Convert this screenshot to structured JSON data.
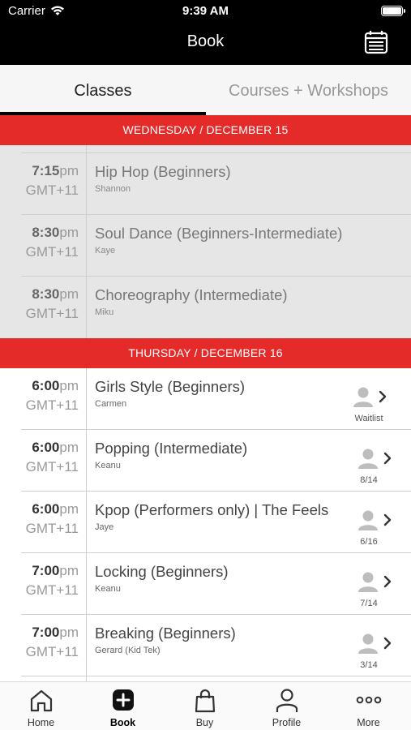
{
  "status": {
    "carrier": "Carrier",
    "time": "9:39 AM"
  },
  "nav": {
    "title": "Book",
    "calendar_icon": "calendar-icon"
  },
  "tabs": {
    "classes": "Classes",
    "courses": "Courses + Workshops"
  },
  "days": [
    {
      "label": "WEDNESDAY / DECEMBER 15"
    },
    {
      "label": "THURSDAY / DECEMBER 16"
    }
  ],
  "past_classes": [
    {
      "time": "7:15",
      "ampm": "pm",
      "tz": "GMT+11",
      "name": "Hip Hop  (Beginners)",
      "teacher": "Shannon"
    },
    {
      "time": "8:30",
      "ampm": "pm",
      "tz": "GMT+11",
      "name": "Soul Dance (Beginners-Intermediate)",
      "teacher": "Kaye"
    },
    {
      "time": "8:30",
      "ampm": "pm",
      "tz": "GMT+11",
      "name": "Choreography (Intermediate)",
      "teacher": "Miku"
    }
  ],
  "classes": [
    {
      "time": "6:00",
      "ampm": "pm",
      "tz": "GMT+11",
      "name": "Girls Style (Beginners)",
      "teacher": "Carmen",
      "availability": "Waitlist"
    },
    {
      "time": "6:00",
      "ampm": "pm",
      "tz": "GMT+11",
      "name": "Popping (Intermediate)",
      "teacher": "Keanu",
      "availability": "8/14"
    },
    {
      "time": "6:00",
      "ampm": "pm",
      "tz": "GMT+11",
      "name": "Kpop (Performers only) | The Feels",
      "teacher": "Jaye",
      "availability": "6/16"
    },
    {
      "time": "7:00",
      "ampm": "pm",
      "tz": "GMT+11",
      "name": "Locking (Beginners)",
      "teacher": "Keanu",
      "availability": "7/14"
    },
    {
      "time": "7:00",
      "ampm": "pm",
      "tz": "GMT+11",
      "name": "Breaking (Beginners)",
      "teacher": "Gerard (Kid Tek)",
      "availability": "3/14"
    }
  ],
  "tabbar": {
    "home": "Home",
    "book": "Book",
    "buy": "Buy",
    "profile": "Profile",
    "more": "More",
    "active": "Book"
  },
  "colors": {
    "accent": "#e52a2a",
    "header": "#000000",
    "past_row": "#e6e6e6"
  }
}
